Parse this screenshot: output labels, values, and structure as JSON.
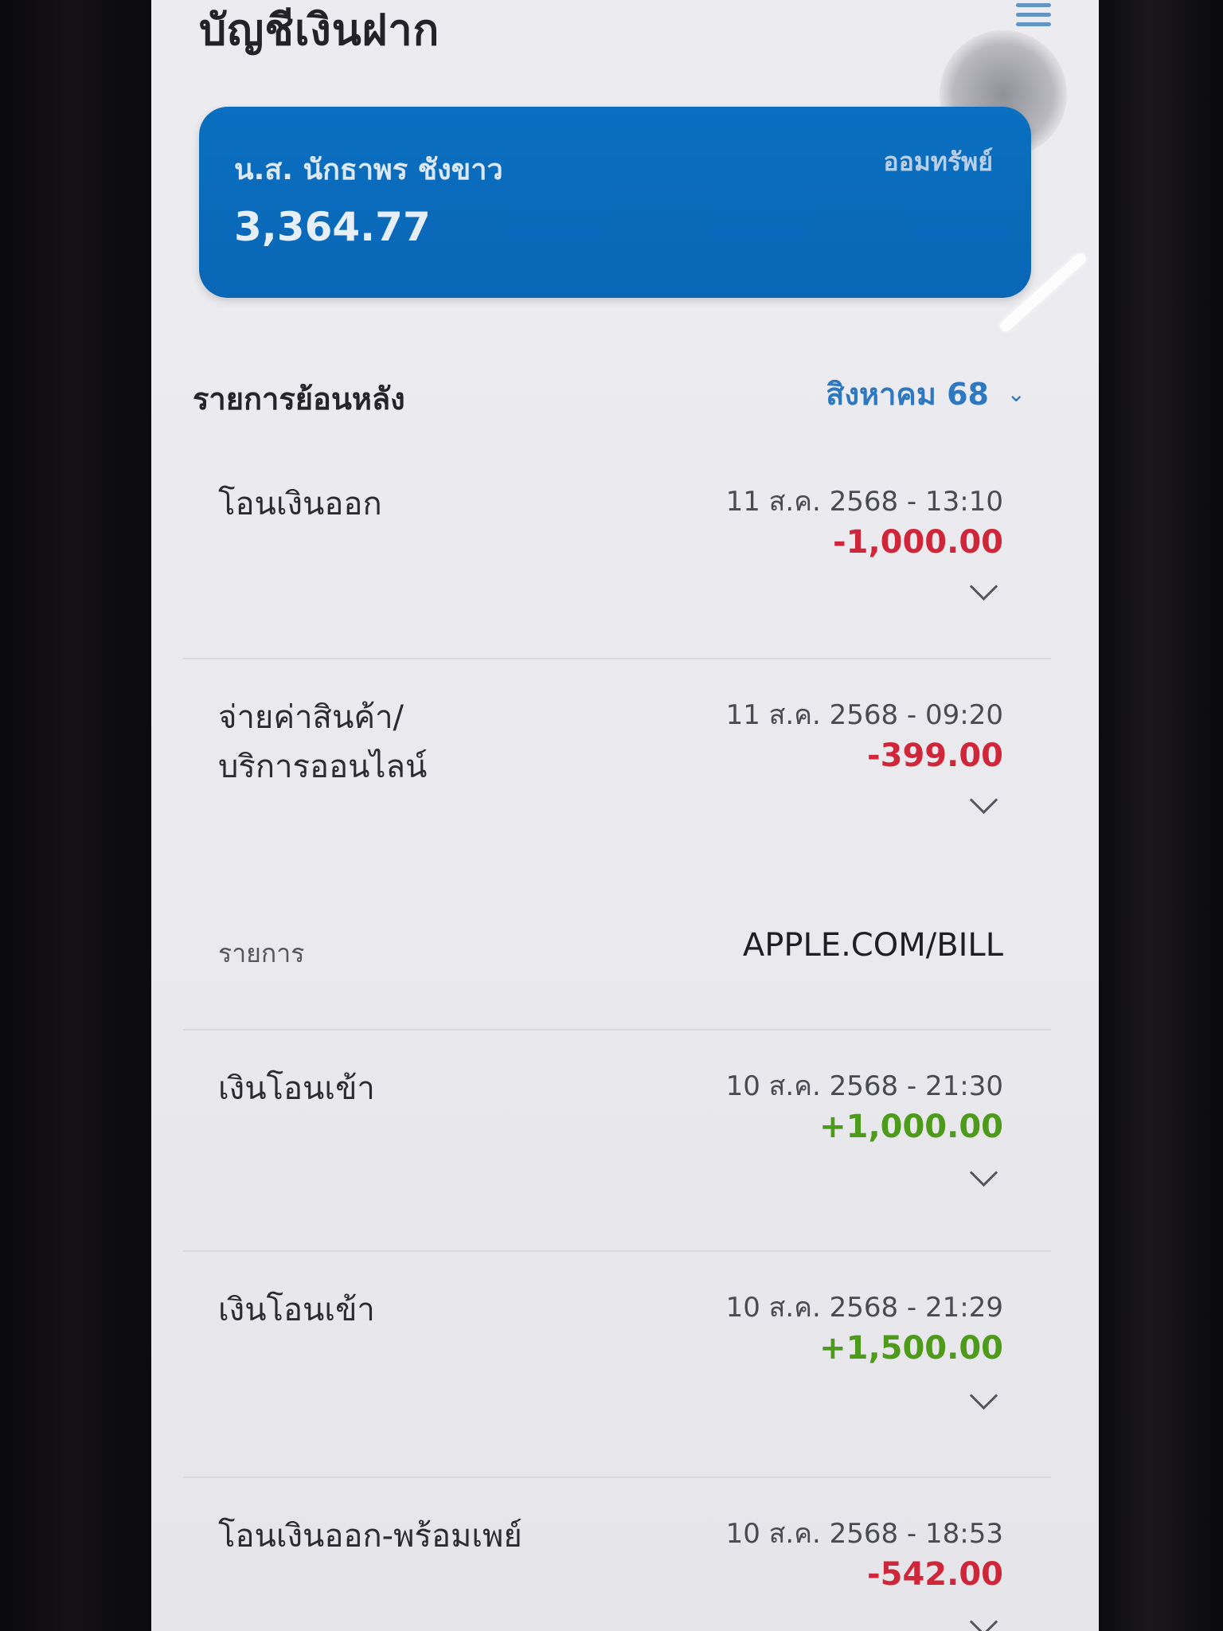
{
  "header": {
    "title": "บัญชีเงินฝาก",
    "menu_icon": "hamburger-menu-icon"
  },
  "account": {
    "holder_name": "น.ส. นักธาพร ชังขาว",
    "type": "ออมทรัพย์",
    "balance": "3,364.77",
    "card_color": "#0a6fc0"
  },
  "history": {
    "title": "รายการย้อนหลัง",
    "month": "สิงหาคม 68",
    "month_icon": "chevron-down-icon",
    "accent_color": "#2d78c0"
  },
  "transactions": [
    {
      "title": "โอนเงินออก",
      "datetime": "11 ส.ค. 2568 - 13:10",
      "amount": "-1,000.00",
      "direction": "out",
      "expanded": false
    },
    {
      "title": "จ่ายค่าสินค้า/\nบริการออนไลน์",
      "datetime": "11 ส.ค. 2568 - 09:20",
      "amount": "-399.00",
      "direction": "out",
      "expanded": true,
      "detail_label": "รายการ",
      "detail_value": "APPLE.COM/BILL"
    },
    {
      "title": "เงินโอนเข้า",
      "datetime": "10 ส.ค. 2568 - 21:30",
      "amount": "+1,000.00",
      "direction": "in",
      "expanded": false
    },
    {
      "title": "เงินโอนเข้า",
      "datetime": "10 ส.ค. 2568 - 21:29",
      "amount": "+1,500.00",
      "direction": "in",
      "expanded": false
    },
    {
      "title": "โอนเงินออก-พร้อมเพย์",
      "datetime": "10 ส.ค. 2568 - 18:53",
      "amount": "-542.00",
      "direction": "out",
      "expanded": false
    }
  ],
  "colors": {
    "negative": "#d0263a",
    "positive": "#4e9a1a"
  }
}
